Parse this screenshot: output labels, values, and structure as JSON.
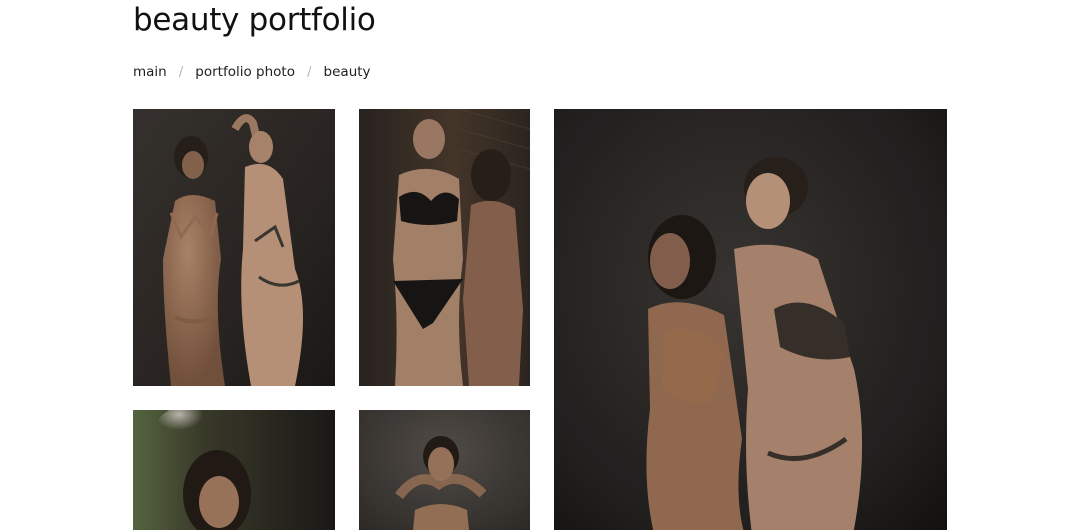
{
  "page": {
    "title": "beauty portfolio"
  },
  "breadcrumb": {
    "items": [
      "main",
      "portfolio photo",
      "beauty"
    ],
    "separator": "/"
  },
  "gallery": {
    "photos": [
      {
        "subject": "two models in bikinis against dark wall"
      },
      {
        "subject": "model in black bikini by wooden wall"
      },
      {
        "subject": "two models in profile, dark background"
      },
      {
        "subject": "portrait of model with blurred foliage"
      },
      {
        "subject": "model with hands behind head"
      }
    ]
  },
  "colors": {
    "background": "#ffffff",
    "text": "#111111",
    "separator": "#b9b9b9",
    "photo_dark": "#2e2824",
    "skin": "#a57a5e"
  }
}
